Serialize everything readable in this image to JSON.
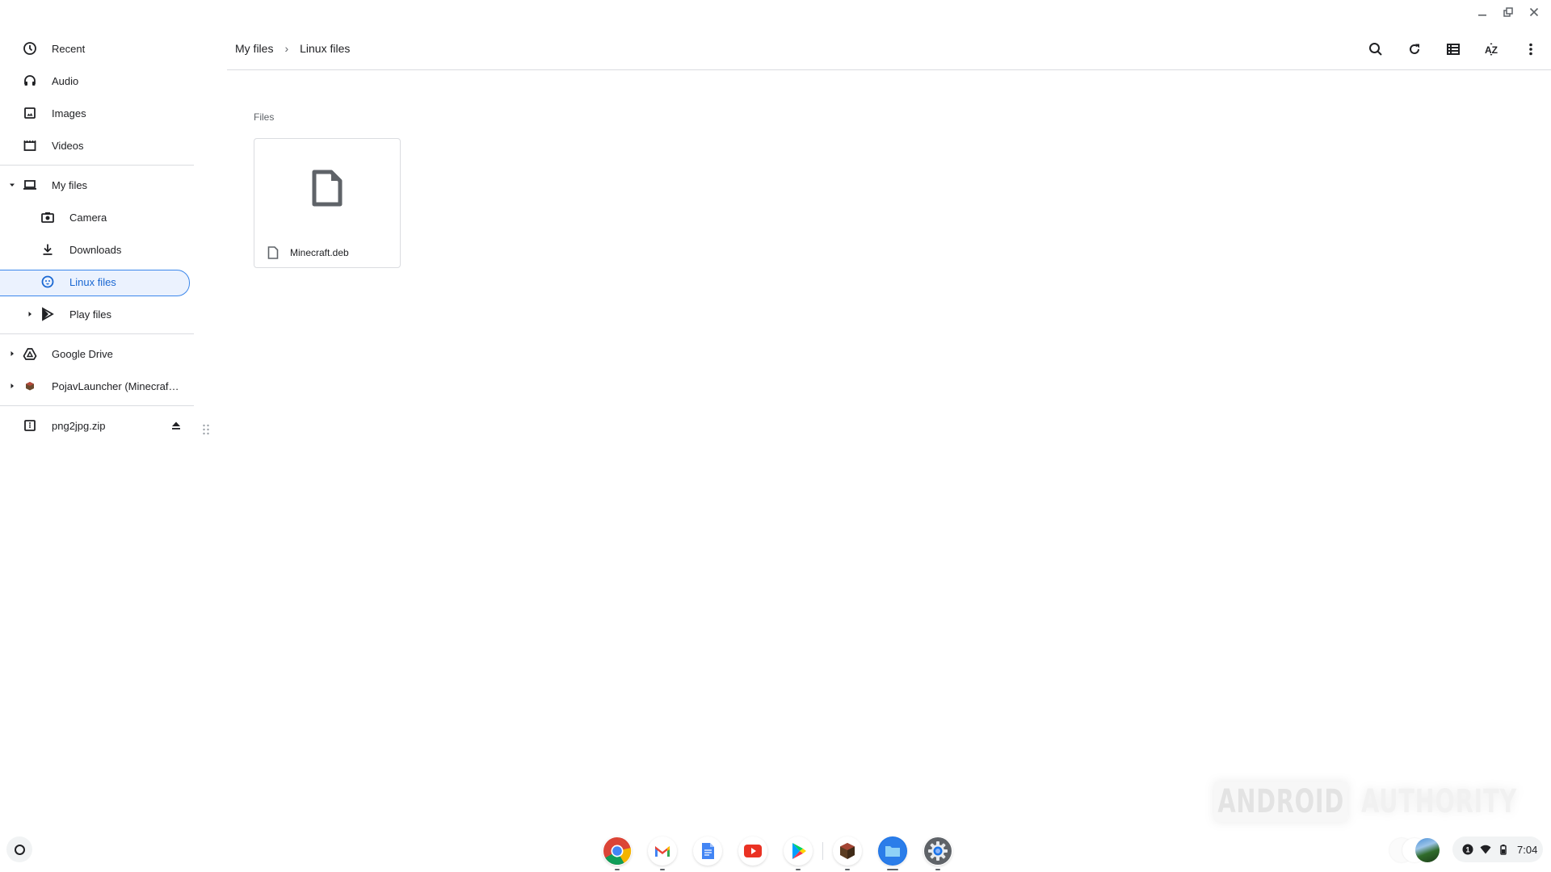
{
  "window": {
    "controls": [
      "minimize",
      "restore",
      "close"
    ]
  },
  "sidebar": {
    "groups": [
      {
        "items": [
          {
            "label": "Recent",
            "icon": "clock-icon"
          },
          {
            "label": "Audio",
            "icon": "headphones-icon"
          },
          {
            "label": "Images",
            "icon": "image-icon"
          },
          {
            "label": "Videos",
            "icon": "video-icon"
          }
        ]
      },
      {
        "items": [
          {
            "label": "My files",
            "icon": "laptop-icon",
            "expanded": true
          },
          {
            "label": "Camera",
            "icon": "camera-icon"
          },
          {
            "label": "Downloads",
            "icon": "download-icon"
          },
          {
            "label": "Linux files",
            "icon": "linux-icon",
            "selected": true
          },
          {
            "label": "Play files",
            "icon": "play-store-icon",
            "expanded": false
          }
        ]
      },
      {
        "items": [
          {
            "label": "Google Drive",
            "icon": "google-drive-icon",
            "expanded": false
          },
          {
            "label": "PojavLauncher (Minecraf…",
            "icon": "pojavlauncher-icon",
            "expanded": false
          }
        ]
      },
      {
        "items": [
          {
            "label": "png2jpg.zip",
            "icon": "archive-icon",
            "action": "eject"
          }
        ]
      }
    ]
  },
  "header": {
    "breadcrumb": [
      "My files",
      "Linux files"
    ],
    "toolbar": [
      "search",
      "refresh",
      "list-view",
      "sort",
      "more"
    ]
  },
  "content": {
    "section_label": "Files",
    "files": [
      {
        "name": "Minecraft.deb",
        "type": "file"
      }
    ]
  },
  "watermark": {
    "left": "ANDROID",
    "right": "AUTHORITY"
  },
  "shelf": {
    "apps": [
      "Chrome",
      "Gmail",
      "Docs",
      "YouTube",
      "Play Store",
      "Minecraft",
      "Files",
      "Settings"
    ],
    "tray": {
      "notification_count": "1",
      "time": "7:04"
    }
  }
}
